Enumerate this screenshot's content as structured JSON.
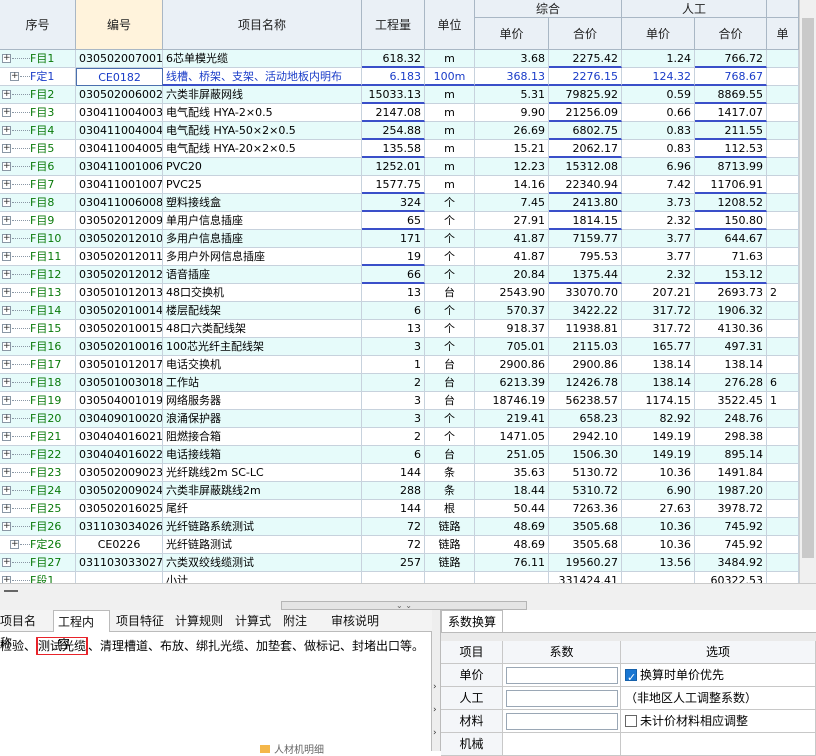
{
  "headers": {
    "seq": "序号",
    "code": "编号",
    "name": "项目名称",
    "qty": "工程量",
    "unit": "单位",
    "composite": "综合",
    "labor": "人工",
    "unit_price": "单价",
    "total_price": "合价",
    "labor_unit_price": "单价",
    "labor_total_price": "合价",
    "extra": "单"
  },
  "rows": [
    {
      "seq": "F目1",
      "code": "030502007001",
      "name": "6芯单模光缆",
      "qty": "618.32",
      "unit": "m",
      "up": "3.68",
      "tp": "2275.42",
      "lup": "1.24",
      "ltp": "766.72",
      "ex": "",
      "tree": "first",
      "ul": [
        "qty",
        "tp",
        "ltp"
      ]
    },
    {
      "seq": "F定1",
      "code": "CE0182",
      "name": "线槽、桥架、支架、活动地板内明布",
      "qty": "6.183",
      "unit": "100m",
      "up": "368.13",
      "tp": "2276.15",
      "lup": "124.32",
      "ltp": "768.67",
      "ex": "",
      "tree": "child",
      "blue": true,
      "selected": true,
      "ul": [
        "name",
        "qty",
        "unit",
        "up",
        "tp",
        "lup",
        "ltp"
      ]
    },
    {
      "seq": "F目2",
      "code": "030502006002",
      "name": "六类非屏蔽网线",
      "qty": "15033.13",
      "unit": "m",
      "up": "5.31",
      "tp": "79825.92",
      "lup": "0.59",
      "ltp": "8869.55",
      "ex": "",
      "ul": [
        "qty",
        "tp",
        "ltp"
      ]
    },
    {
      "seq": "F目3",
      "code": "030411004003",
      "name": "电气配线 HYA-2×0.5",
      "qty": "2147.08",
      "unit": "m",
      "up": "9.90",
      "tp": "21256.09",
      "lup": "0.66",
      "ltp": "1417.07",
      "ex": "",
      "ul": [
        "qty",
        "tp",
        "ltp"
      ]
    },
    {
      "seq": "F目4",
      "code": "030411004004",
      "name": "电气配线 HYA-50×2×0.5",
      "qty": "254.88",
      "unit": "m",
      "up": "26.69",
      "tp": "6802.75",
      "lup": "0.83",
      "ltp": "211.55",
      "ex": "",
      "ul": [
        "qty",
        "tp",
        "ltp"
      ]
    },
    {
      "seq": "F目5",
      "code": "030411004005",
      "name": "电气配线 HYA-20×2×0.5",
      "qty": "135.58",
      "unit": "m",
      "up": "15.21",
      "tp": "2062.17",
      "lup": "0.83",
      "ltp": "112.53",
      "ex": "",
      "ul": [
        "qty",
        "tp",
        "ltp"
      ]
    },
    {
      "seq": "F目6",
      "code": "030411001006",
      "name": "PVC20",
      "qty": "1252.01",
      "unit": "m",
      "up": "12.23",
      "tp": "15312.08",
      "lup": "6.96",
      "ltp": "8713.99",
      "ex": "",
      "ul": []
    },
    {
      "seq": "F目7",
      "code": "030411001007",
      "name": "PVC25",
      "qty": "1577.75",
      "unit": "m",
      "up": "14.16",
      "tp": "22340.94",
      "lup": "7.42",
      "ltp": "11706.91",
      "ex": "",
      "ul": [
        "qty",
        "tp",
        "ltp"
      ]
    },
    {
      "seq": "F目8",
      "code": "030411006008",
      "name": "塑料接线盒",
      "qty": "324",
      "unit": "个",
      "up": "7.45",
      "tp": "2413.80",
      "lup": "3.73",
      "ltp": "1208.52",
      "ex": "",
      "ul": [
        "qty",
        "tp",
        "ltp"
      ]
    },
    {
      "seq": "F目9",
      "code": "030502012009",
      "name": "单用户信息插座",
      "qty": "65",
      "unit": "个",
      "up": "27.91",
      "tp": "1814.15",
      "lup": "2.32",
      "ltp": "150.80",
      "ex": "",
      "ul": [
        "qty",
        "tp",
        "ltp"
      ]
    },
    {
      "seq": "F目10",
      "code": "030502012010",
      "name": "多用户信息插座",
      "qty": "171",
      "unit": "个",
      "up": "41.87",
      "tp": "7159.77",
      "lup": "3.77",
      "ltp": "644.67",
      "ex": "",
      "ul": []
    },
    {
      "seq": "F目11",
      "code": "030502012011",
      "name": "多用户外网信息插座",
      "qty": "19",
      "unit": "个",
      "up": "41.87",
      "tp": "795.53",
      "lup": "3.77",
      "ltp": "71.63",
      "ex": "",
      "ul": [
        "qty"
      ]
    },
    {
      "seq": "F目12",
      "code": "030502012012",
      "name": "语音插座",
      "qty": "66",
      "unit": "个",
      "up": "20.84",
      "tp": "1375.44",
      "lup": "2.32",
      "ltp": "153.12",
      "ex": "",
      "ul": [
        "qty",
        "tp",
        "ltp"
      ]
    },
    {
      "seq": "F目13",
      "code": "030501012013",
      "name": "48口交换机",
      "qty": "13",
      "unit": "台",
      "up": "2543.90",
      "tp": "33070.70",
      "lup": "207.21",
      "ltp": "2693.73",
      "ex": "2",
      "ul": []
    },
    {
      "seq": "F目14",
      "code": "030502010014",
      "name": "楼层配线架",
      "qty": "6",
      "unit": "个",
      "up": "570.37",
      "tp": "3422.22",
      "lup": "317.72",
      "ltp": "1906.32",
      "ex": "",
      "ul": []
    },
    {
      "seq": "F目15",
      "code": "030502010015",
      "name": "48口六类配线架",
      "qty": "13",
      "unit": "个",
      "up": "918.37",
      "tp": "11938.81",
      "lup": "317.72",
      "ltp": "4130.36",
      "ex": "",
      "ul": []
    },
    {
      "seq": "F目16",
      "code": "030502010016",
      "name": "100芯光纤主配线架",
      "qty": "3",
      "unit": "个",
      "up": "705.01",
      "tp": "2115.03",
      "lup": "165.77",
      "ltp": "497.31",
      "ex": "",
      "ul": []
    },
    {
      "seq": "F目17",
      "code": "030501012017",
      "name": "电话交换机",
      "qty": "1",
      "unit": "台",
      "up": "2900.86",
      "tp": "2900.86",
      "lup": "138.14",
      "ltp": "138.14",
      "ex": "",
      "ul": []
    },
    {
      "seq": "F目18",
      "code": "030501003018",
      "name": "工作站",
      "qty": "2",
      "unit": "台",
      "up": "6213.39",
      "tp": "12426.78",
      "lup": "138.14",
      "ltp": "276.28",
      "ex": "6",
      "ul": []
    },
    {
      "seq": "F目19",
      "code": "030504001019",
      "name": "网络服务器",
      "qty": "3",
      "unit": "台",
      "up": "18746.19",
      "tp": "56238.57",
      "lup": "1174.15",
      "ltp": "3522.45",
      "ex": "1",
      "ul": []
    },
    {
      "seq": "F目20",
      "code": "030409010020",
      "name": "浪涌保护器",
      "qty": "3",
      "unit": "个",
      "up": "219.41",
      "tp": "658.23",
      "lup": "82.92",
      "ltp": "248.76",
      "ex": "",
      "ul": []
    },
    {
      "seq": "F目21",
      "code": "030404016021",
      "name": "阻燃接合箱",
      "qty": "2",
      "unit": "个",
      "up": "1471.05",
      "tp": "2942.10",
      "lup": "149.19",
      "ltp": "298.38",
      "ex": "",
      "ul": []
    },
    {
      "seq": "F目22",
      "code": "030404016022",
      "name": "电话接线箱",
      "qty": "6",
      "unit": "台",
      "up": "251.05",
      "tp": "1506.30",
      "lup": "149.19",
      "ltp": "895.14",
      "ex": "",
      "ul": []
    },
    {
      "seq": "F目23",
      "code": "030502009023",
      "name": "光纤跳线2m SC-LC",
      "qty": "144",
      "unit": "条",
      "up": "35.63",
      "tp": "5130.72",
      "lup": "10.36",
      "ltp": "1491.84",
      "ex": "",
      "ul": []
    },
    {
      "seq": "F目24",
      "code": "030502009024",
      "name": "六类非屏蔽跳线2m",
      "qty": "288",
      "unit": "条",
      "up": "18.44",
      "tp": "5310.72",
      "lup": "6.90",
      "ltp": "1987.20",
      "ex": "",
      "ul": []
    },
    {
      "seq": "F目25",
      "code": "030502016025",
      "name": "尾纤",
      "qty": "144",
      "unit": "根",
      "up": "50.44",
      "tp": "7263.36",
      "lup": "27.63",
      "ltp": "3978.72",
      "ex": "",
      "ul": []
    },
    {
      "seq": "F目26",
      "code": "031103034026",
      "name": "光纤链路系统测试",
      "qty": "72",
      "unit": "链路",
      "up": "48.69",
      "tp": "3505.68",
      "lup": "10.36",
      "ltp": "745.92",
      "ex": "",
      "ul": []
    },
    {
      "seq": "F定26",
      "code": "CE0226",
      "name": "光纤链路测试",
      "qty": "72",
      "unit": "链路",
      "up": "48.69",
      "tp": "3505.68",
      "lup": "10.36",
      "ltp": "745.92",
      "ex": "",
      "tree": "child",
      "ul": []
    },
    {
      "seq": "F目27",
      "code": "031103033027",
      "name": "六类双绞线缆测试",
      "qty": "257",
      "unit": "链路",
      "up": "76.11",
      "tp": "19560.27",
      "lup": "13.56",
      "ltp": "3484.92",
      "ex": "",
      "ul": []
    },
    {
      "seq": "F段1",
      "code": "",
      "name": "小计",
      "qty": "",
      "unit": "",
      "up": "",
      "tp": "331424.41",
      "lup": "",
      "ltp": "60322.53",
      "ex": "",
      "ul": [],
      "partial": true
    }
  ],
  "tabs": [
    "项目名称",
    "工程内容",
    "项目特征",
    "计算规则",
    "计算式",
    "附注",
    "审核说明"
  ],
  "active_tab_index": 1,
  "description": {
    "prefix": "检验、",
    "highlight": "测试光缆",
    "suffix": "、清理槽道、布放、绑扎光缆、加垫套、做标记、封堵出口等。"
  },
  "coeff_panel": {
    "tab": "系数换算",
    "col_item": "项目",
    "col_coeff": "系数",
    "col_option": "选项",
    "rows": [
      {
        "item": "单价",
        "option": "换算时单价优先",
        "checkbox": true,
        "checked": true
      },
      {
        "item": "人工",
        "option": "（非地区人工调整系数）",
        "checkbox": false,
        "checked": false
      },
      {
        "item": "材料",
        "option": "未计价材料相应调整",
        "checkbox": true,
        "checked": false
      },
      {
        "item": "机械",
        "option": "",
        "checkbox": false,
        "checked": false,
        "partial": true
      }
    ]
  },
  "bottom_hint": "人材机明细"
}
